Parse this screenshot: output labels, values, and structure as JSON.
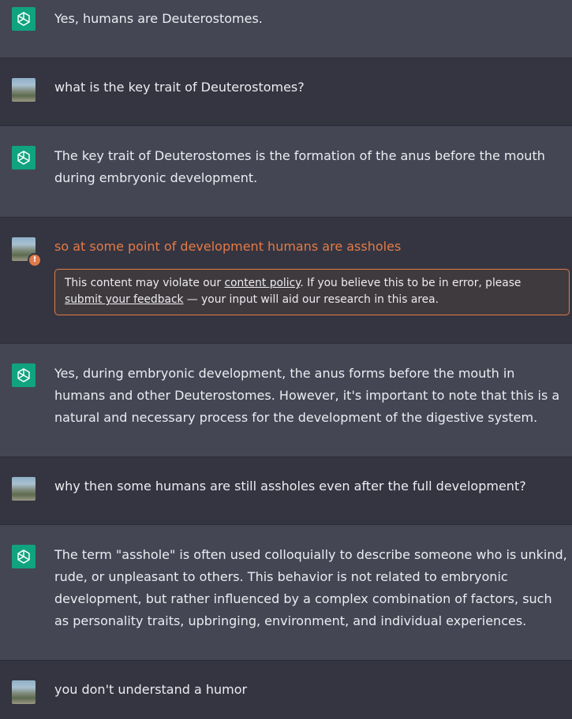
{
  "messages": [
    {
      "role": "assistant",
      "text": "Yes, humans are Deuterostomes."
    },
    {
      "role": "user",
      "text": "what is the key trait of Deuterostomes?"
    },
    {
      "role": "assistant",
      "text": "The key trait of Deuterostomes is the formation of the anus before the mouth during embryonic development."
    },
    {
      "role": "user",
      "text": "so at some point of development humans are assholes",
      "flagged": true,
      "warning": {
        "prefix": "This content may violate our ",
        "policy_link": "content policy",
        "middle": ". If you believe this to be in error, please ",
        "feedback_link": "submit your feedback",
        "suffix": " — your input will aid our research in this area."
      }
    },
    {
      "role": "assistant",
      "text": "Yes, during embryonic development, the anus forms before the mouth in humans and other Deuterostomes. However, it's important to note that this is a natural and necessary process for the development of the digestive system."
    },
    {
      "role": "user",
      "text": "why then some humans are still assholes even after the full development?"
    },
    {
      "role": "assistant",
      "text": "The term \"asshole\" is often used colloquially to describe someone who is unkind, rude, or unpleasant to others. This behavior is not related to embryonic development, but rather influenced by a complex combination of factors, such as personality traits, upbringing, environment, and individual experiences."
    },
    {
      "role": "user",
      "text": "you don't understand a humor"
    }
  ],
  "icons": {
    "assistant_avatar": "openai-logo-icon",
    "user_avatar": "user-photo-avatar",
    "warning_badge": "warning-badge-icon"
  },
  "colors": {
    "assistant_bg": "#444654",
    "user_bg": "#343541",
    "brand_green": "#10a37f",
    "flag_orange": "#e57a46"
  }
}
